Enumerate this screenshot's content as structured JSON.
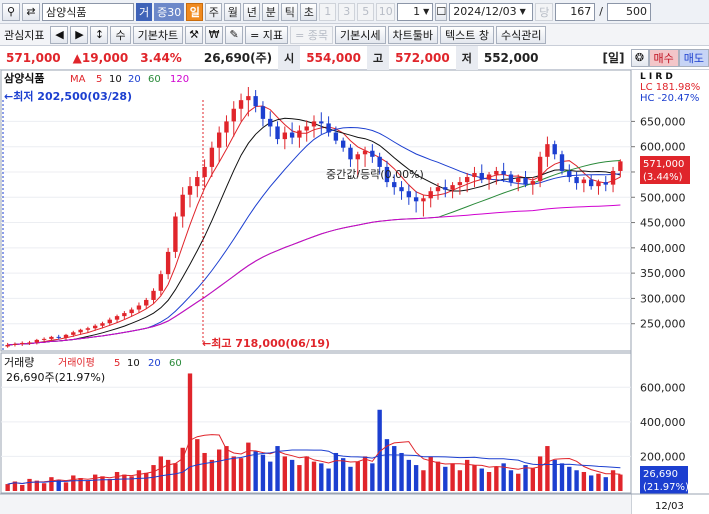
{
  "toolbar": {
    "stock_name": "삼양식품",
    "tab_geo": "거",
    "tab_jeung": "증30",
    "periods": [
      "일",
      "주",
      "월",
      "년",
      "분",
      "틱",
      "초"
    ],
    "period_nums": [
      "1",
      "3",
      "5",
      "10"
    ],
    "interval_value": "1",
    "date": "2024/12/03",
    "dang_label": "당",
    "count": "167",
    "slash": "/",
    "total": "500"
  },
  "toolbar2": {
    "watch": "관심지표",
    "su": "수",
    "basic_chart": "기본차트",
    "won": "₩",
    "indicator": "= 지표",
    "stock_item": "= 종목",
    "basic_quote": "기본시세",
    "chart_bar": "차트툴바",
    "text_window": "텍스트 창",
    "formula": "수식관리"
  },
  "quote": {
    "price": "571,000",
    "change": "▲19,000",
    "change_pct": "3.44%",
    "volume": "26,690(주)",
    "open_label": "시",
    "open": "554,000",
    "high_label": "고",
    "high": "572,000",
    "low_label": "저",
    "low": "552,000",
    "period_tag": "[일]",
    "buy": "매수",
    "sell": "매도"
  },
  "price_panel": {
    "name": "삼양식품",
    "ma_label": "MA",
    "ma_periods": [
      "5",
      "10",
      "20",
      "60",
      "120"
    ],
    "ma_colors": [
      "#e0252b",
      "#111111",
      "#1c3fd0",
      "#2a8a3a",
      "#d000d0"
    ],
    "low_marker": "←최저 202,500(03/28)",
    "high_marker": "←최고 718,000(06/19)",
    "mid_text": "중간값/등락(0.00%)",
    "lc": "LC 181.98%",
    "hc": "HC -20.47%",
    "right_tags": "L I R D",
    "current_tag": "571,000",
    "current_pct": "(3.44%)"
  },
  "volume_panel": {
    "label": "거래량",
    "avg_label": "거래이평",
    "avg_periods": [
      "5",
      "10",
      "20",
      "60"
    ],
    "last": "26,690주(21.97%)",
    "current_tag": "26,690",
    "current_pct": "(21.97%)"
  },
  "axes": {
    "price_ticks": [
      "650,000",
      "600,000",
      "550,000",
      "500,000",
      "450,000",
      "400,000",
      "350,000",
      "300,000",
      "250,000"
    ],
    "volume_ticks": [
      "600,000",
      "400,000",
      "200,000"
    ],
    "x_labels": [
      "2024/03",
      "05",
      "06",
      "07",
      "08",
      "09",
      "10",
      "11",
      "12"
    ],
    "date_corner": "12/03"
  },
  "chart_data": {
    "type": "line",
    "price_range": [
      200000,
      720000
    ],
    "candles": [
      [
        205,
        202.5,
        212,
        208
      ],
      [
        208,
        205,
        213,
        210
      ],
      [
        210,
        206,
        215,
        212
      ],
      [
        212,
        208,
        216,
        213
      ],
      [
        213,
        209,
        220,
        218
      ],
      [
        218,
        214,
        223,
        220
      ],
      [
        220,
        216,
        226,
        224
      ],
      [
        224,
        219,
        228,
        222
      ],
      [
        222,
        218,
        230,
        228
      ],
      [
        228,
        224,
        236,
        233
      ],
      [
        233,
        228,
        240,
        238
      ],
      [
        238,
        232,
        244,
        241
      ],
      [
        241,
        236,
        249,
        246
      ],
      [
        246,
        241,
        254,
        251
      ],
      [
        251,
        246,
        262,
        258
      ],
      [
        258,
        252,
        268,
        265
      ],
      [
        265,
        259,
        275,
        271
      ],
      [
        271,
        264,
        282,
        278
      ],
      [
        278,
        272,
        292,
        286
      ],
      [
        286,
        280,
        301,
        297
      ],
      [
        297,
        290,
        320,
        315
      ],
      [
        315,
        306,
        355,
        348
      ],
      [
        348,
        338,
        400,
        392
      ],
      [
        392,
        380,
        470,
        462
      ],
      [
        462,
        440,
        520,
        505
      ],
      [
        505,
        480,
        540,
        522
      ],
      [
        522,
        500,
        552,
        540
      ],
      [
        540,
        520,
        575,
        560
      ],
      [
        560,
        540,
        610,
        598
      ],
      [
        598,
        570,
        640,
        628
      ],
      [
        628,
        600,
        662,
        650
      ],
      [
        650,
        620,
        690,
        675
      ],
      [
        675,
        650,
        705,
        692
      ],
      [
        692,
        660,
        718,
        700
      ],
      [
        700,
        668,
        712,
        680
      ],
      [
        680,
        640,
        690,
        655
      ],
      [
        655,
        620,
        670,
        640
      ],
      [
        640,
        605,
        650,
        615
      ],
      [
        615,
        595,
        640,
        628
      ],
      [
        628,
        605,
        648,
        618
      ],
      [
        618,
        598,
        642,
        632
      ],
      [
        632,
        610,
        652,
        640
      ],
      [
        640,
        618,
        662,
        650
      ],
      [
        650,
        625,
        668,
        646
      ],
      [
        646,
        620,
        660,
        628
      ],
      [
        628,
        605,
        640,
        612
      ],
      [
        612,
        590,
        618,
        598
      ],
      [
        598,
        560,
        605,
        575
      ],
      [
        575,
        540,
        590,
        585
      ],
      [
        585,
        560,
        600,
        592
      ],
      [
        592,
        568,
        605,
        580
      ],
      [
        580,
        545,
        588,
        560
      ],
      [
        560,
        520,
        572,
        530
      ],
      [
        530,
        505,
        545,
        520
      ],
      [
        520,
        495,
        532,
        512
      ],
      [
        512,
        485,
        525,
        500
      ],
      [
        500,
        470,
        512,
        492
      ],
      [
        492,
        462,
        505,
        498
      ],
      [
        498,
        480,
        520,
        512
      ],
      [
        512,
        495,
        528,
        520
      ],
      [
        520,
        500,
        535,
        515
      ],
      [
        515,
        498,
        530,
        524
      ],
      [
        524,
        505,
        540,
        530
      ],
      [
        530,
        510,
        548,
        540
      ],
      [
        540,
        520,
        560,
        548
      ],
      [
        548,
        528,
        565,
        535
      ],
      [
        535,
        515,
        550,
        545
      ],
      [
        545,
        525,
        560,
        552
      ],
      [
        552,
        530,
        568,
        545
      ],
      [
        545,
        522,
        552,
        530
      ],
      [
        530,
        512,
        545,
        538
      ],
      [
        538,
        520,
        552,
        525
      ],
      [
        525,
        505,
        540,
        532
      ],
      [
        532,
        520,
        590,
        580
      ],
      [
        580,
        560,
        620,
        605
      ],
      [
        605,
        575,
        612,
        585
      ],
      [
        585,
        545,
        592,
        552
      ],
      [
        552,
        530,
        565,
        540
      ],
      [
        540,
        515,
        550,
        528
      ],
      [
        528,
        510,
        540,
        535
      ],
      [
        535,
        515,
        545,
        522
      ],
      [
        522,
        505,
        535,
        530
      ],
      [
        530,
        512,
        542,
        525
      ],
      [
        525,
        510,
        560,
        552
      ],
      [
        552,
        540,
        575,
        571
      ]
    ],
    "volume": [
      40,
      55,
      35,
      70,
      60,
      45,
      80,
      65,
      50,
      90,
      75,
      60,
      95,
      85,
      70,
      110,
      95,
      85,
      120,
      105,
      150,
      200,
      180,
      160,
      250,
      680,
      300,
      220,
      180,
      240,
      260,
      200,
      190,
      280,
      230,
      210,
      170,
      260,
      200,
      180,
      150,
      200,
      170,
      160,
      130,
      220,
      190,
      140,
      170,
      200,
      160,
      470,
      300,
      260,
      220,
      180,
      150,
      120,
      200,
      170,
      140,
      160,
      120,
      180,
      150,
      130,
      110,
      140,
      160,
      120,
      100,
      150,
      130,
      200,
      260,
      180,
      160,
      140,
      120,
      110,
      90,
      100,
      80,
      120,
      95
    ],
    "volume_range": [
      0,
      700000
    ]
  }
}
